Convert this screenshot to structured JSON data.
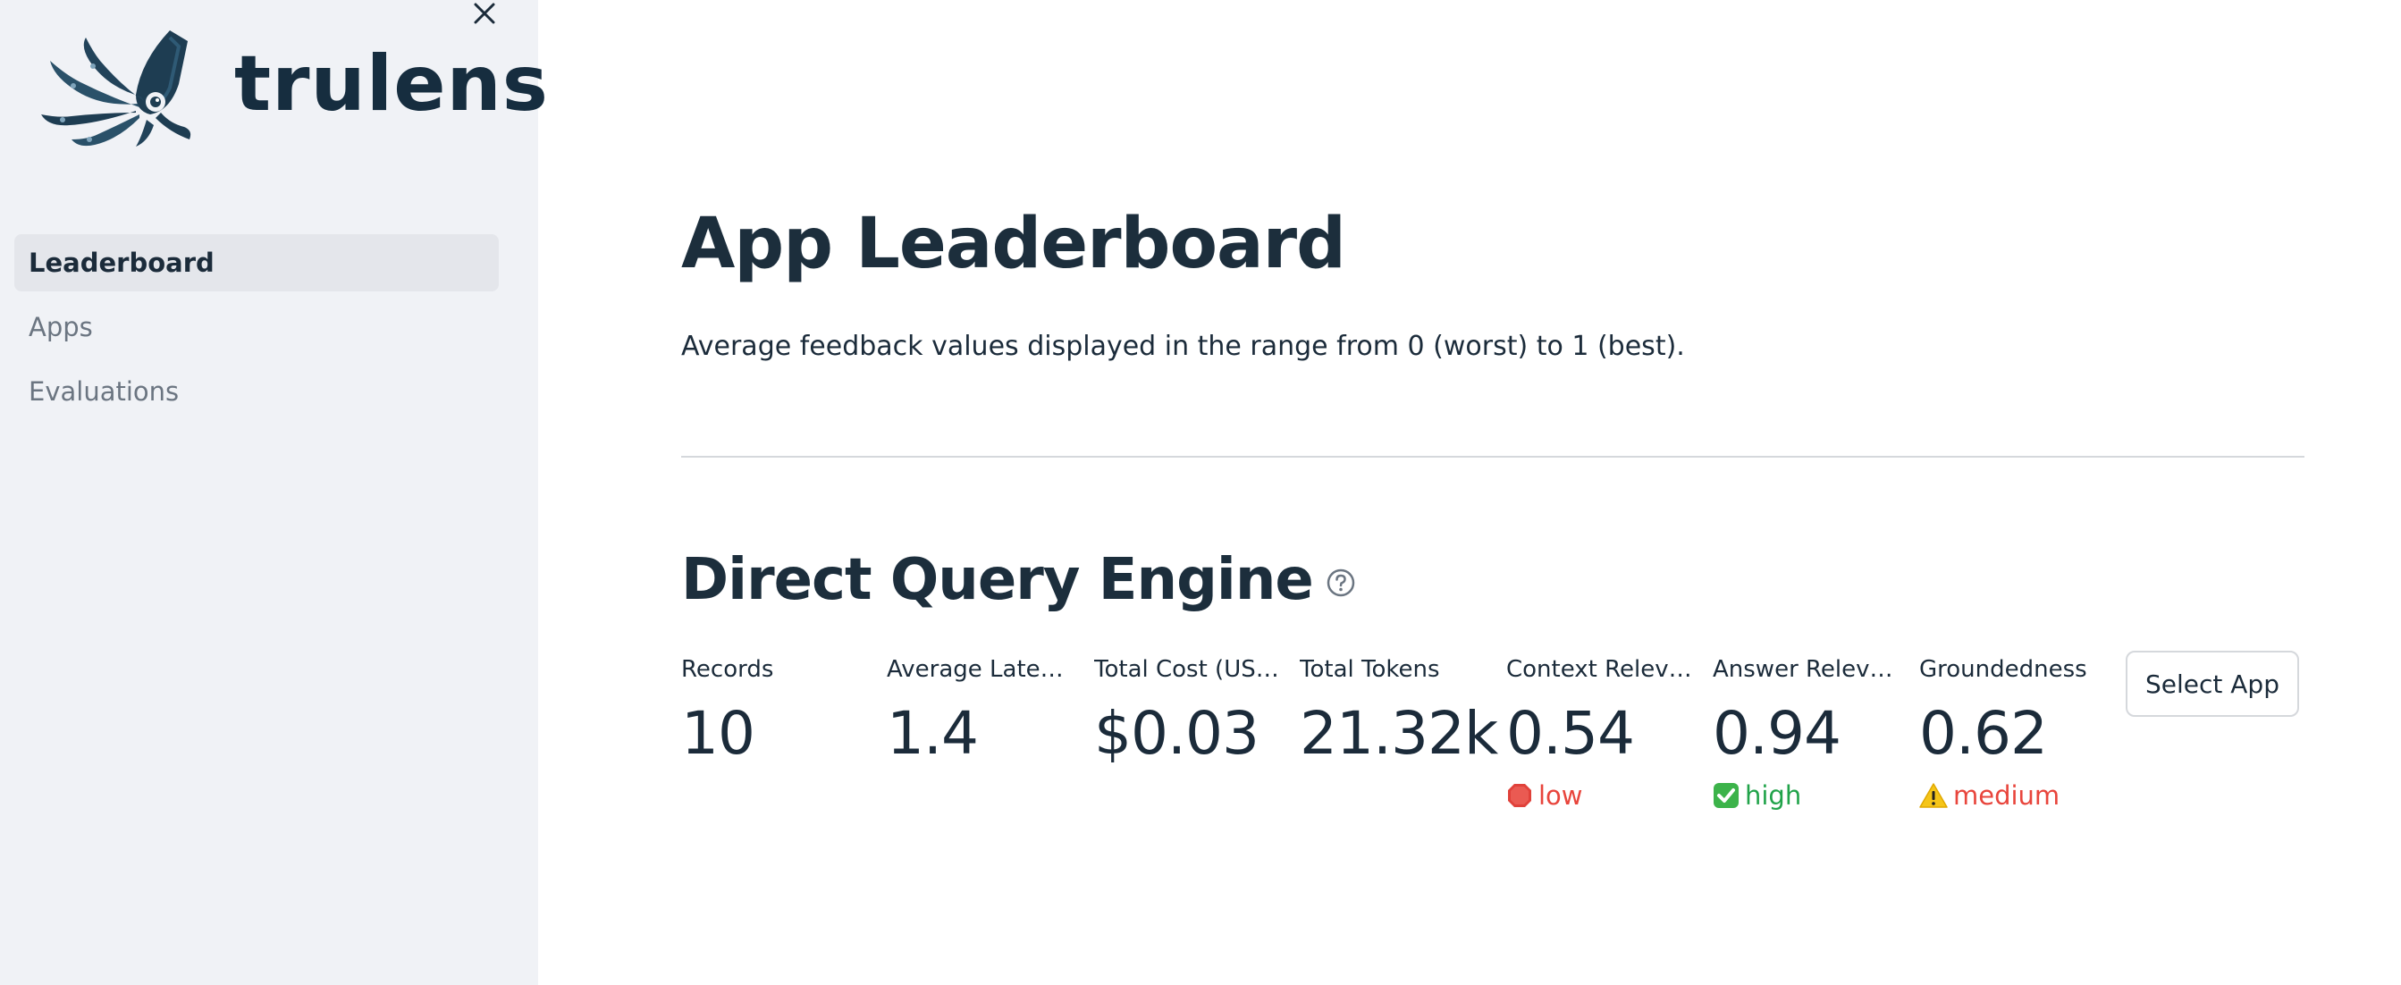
{
  "sidebar": {
    "brand_name": "trulens",
    "nav_items": [
      {
        "label": "Leaderboard",
        "active": true
      },
      {
        "label": "Apps",
        "active": false
      },
      {
        "label": "Evaluations",
        "active": false
      }
    ]
  },
  "main": {
    "title": "App Leaderboard",
    "subtitle": "Average feedback values displayed in the range from 0 (worst) to 1 (best).",
    "app": {
      "name": "Direct Query Engine",
      "metrics": [
        {
          "label": "Records",
          "value": "10"
        },
        {
          "label": "Average Laten…",
          "value": "1.4"
        },
        {
          "label": "Total Cost (USD)",
          "value": "$0.03"
        },
        {
          "label": "Total Tokens",
          "value": "21.32k"
        },
        {
          "label": "Context Relev…",
          "value": "0.54",
          "delta": "low",
          "delta_icon": "stop-icon",
          "delta_color": "#e8453c"
        },
        {
          "label": "Answer Releva…",
          "value": "0.94",
          "delta": "high",
          "delta_icon": "check-icon",
          "delta_color": "#21a34a"
        },
        {
          "label": "Groundedness",
          "value": "0.62",
          "delta": "medium",
          "delta_icon": "warning-icon",
          "delta_color": "#e8453c"
        }
      ],
      "select_button_label": "Select App"
    }
  },
  "colors": {
    "sidebar_bg": "#f0f2f6",
    "text": "#1b2b3a",
    "low": "#e8453c",
    "high": "#21a34a"
  }
}
